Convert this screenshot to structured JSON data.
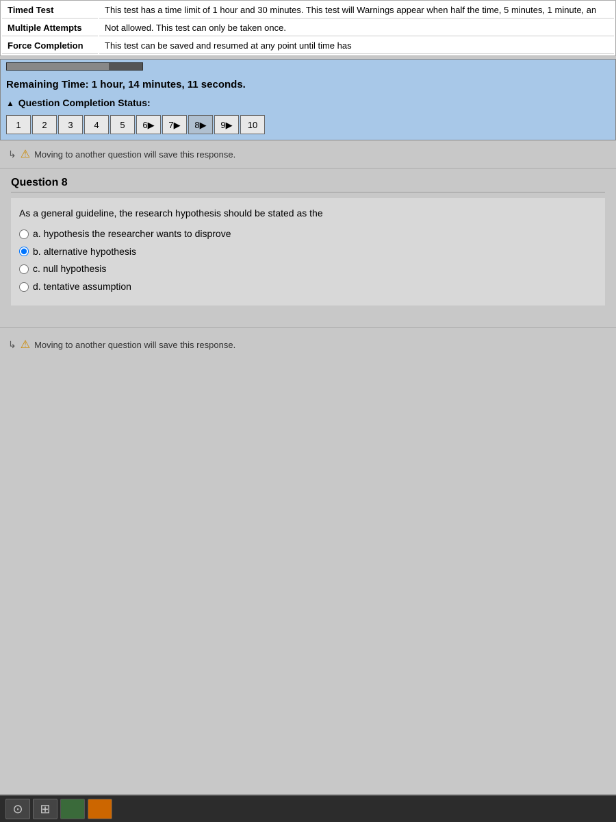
{
  "header": {
    "timed_test_label": "Timed Test",
    "timed_test_desc": "This test has a time limit of 1 hour and 30 minutes. This test will Warnings appear when half the time, 5 minutes, 1 minute, an",
    "multiple_attempts_label": "Multiple Attempts",
    "multiple_attempts_desc": "Not allowed. This test can only be taken once.",
    "force_completion_label": "Force Completion",
    "force_completion_desc": "This test can be saved and resumed at any point until time has"
  },
  "timer": {
    "remaining_time": "Remaining Time: 1 hour, 14 minutes, 11 seconds.",
    "progress_percent": 75
  },
  "completion_status": {
    "label": "Question Completion Status:"
  },
  "question_buttons": [
    {
      "number": "1",
      "active": false
    },
    {
      "number": "2",
      "active": false
    },
    {
      "number": "3",
      "active": false
    },
    {
      "number": "4",
      "active": false
    },
    {
      "number": "5",
      "active": false
    },
    {
      "number": "6▶",
      "active": false
    },
    {
      "number": "7▶",
      "active": false
    },
    {
      "number": "8▶",
      "active": true
    },
    {
      "number": "9▶",
      "active": false
    },
    {
      "number": "10",
      "active": false
    }
  ],
  "warning_top": {
    "text": "Moving to another question will save this response."
  },
  "question": {
    "title": "Question 8",
    "text": "As a general guideline, the research hypothesis should be stated as the",
    "options": [
      {
        "id": "a",
        "label": "a. hypothesis the researcher wants to disprove",
        "selected": false
      },
      {
        "id": "b",
        "label": "b. alternative hypothesis",
        "selected": true
      },
      {
        "id": "c",
        "label": "c. null hypothesis",
        "selected": false
      },
      {
        "id": "d",
        "label": "d. tentative assumption",
        "selected": false
      }
    ]
  },
  "warning_bottom": {
    "text": "Moving to another question will save this response."
  },
  "taskbar": {
    "search_label": "⊙",
    "file_label": "📁",
    "circle_label": "●"
  }
}
